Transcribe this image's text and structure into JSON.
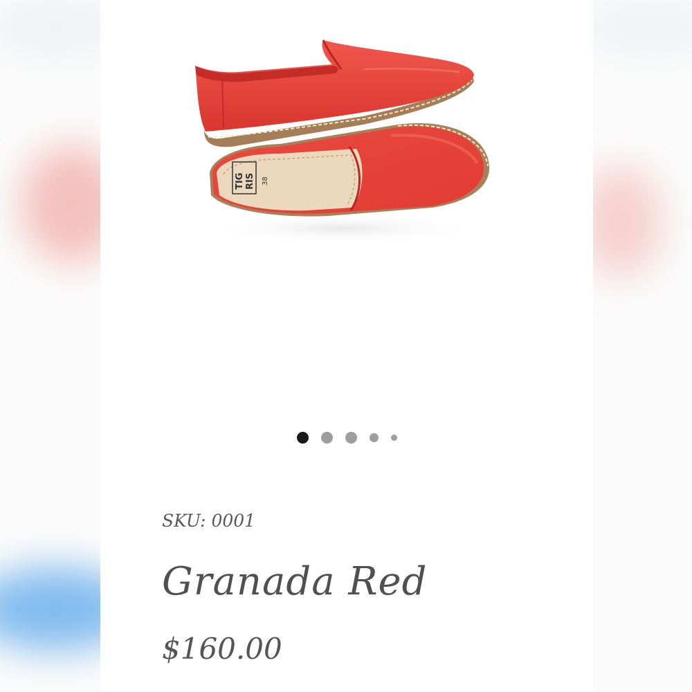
{
  "product": {
    "sku_text": "SKU: 0001",
    "name": "Granada Red",
    "price": "$160.00",
    "image_alt": "Red leather slip-on shoes",
    "label_brand": "TIG RIS",
    "label_size": "38"
  },
  "gallery": {
    "total_slides": 5,
    "active_slide": 1
  },
  "colors": {
    "shoe_red": "#e8453c",
    "sole_tan": "#b08a63",
    "dot_active": "#1a1a1a",
    "dot_inactive": "#9e9e9e",
    "text": "#505050"
  }
}
